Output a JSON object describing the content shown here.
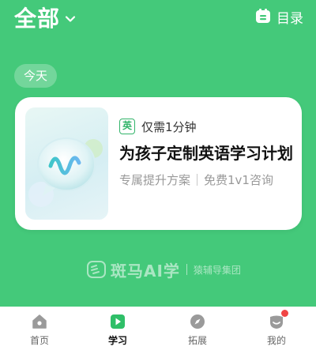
{
  "header": {
    "title": "全部",
    "catalog_label": "目录"
  },
  "section": {
    "today_label": "今天"
  },
  "card": {
    "tag": "英",
    "duration": "仅需1分钟",
    "title": "为孩子定制英语学习计划",
    "sub_left": "专属提升方案",
    "sub_right": "免费1v1咨询"
  },
  "brand": {
    "name": "斑马AI学",
    "group": "猿辅导集团"
  },
  "tabs": [
    {
      "label": "首页",
      "icon": "home-icon"
    },
    {
      "label": "学习",
      "icon": "play-icon"
    },
    {
      "label": "拓展",
      "icon": "compass-icon"
    },
    {
      "label": "我的",
      "icon": "profile-icon"
    }
  ],
  "colors": {
    "background": "#44c97a",
    "accent": "#32b46a",
    "badge": "#f04545"
  }
}
